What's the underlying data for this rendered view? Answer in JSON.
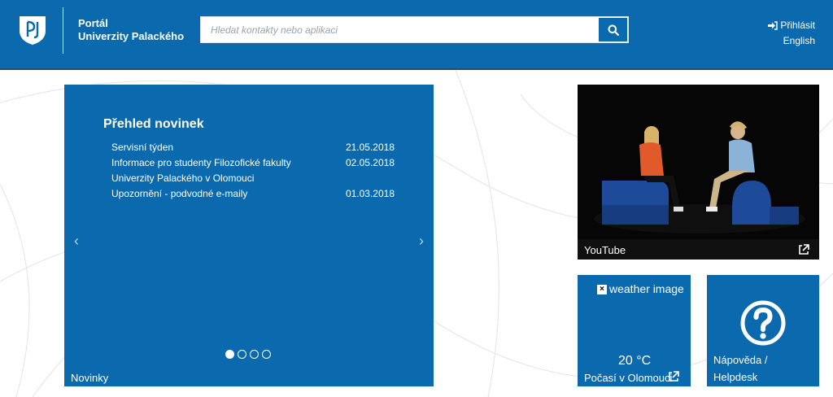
{
  "header": {
    "title_line1": "Portál",
    "title_line2": "Univerzity Palackého",
    "search_placeholder": "Hledat kontakty nebo aplikaci",
    "login_label": "Přihlásit",
    "language_label": "English"
  },
  "news_tile": {
    "heading": "Přehled novinek",
    "items": [
      {
        "title": "Servisní týden",
        "date": "21.05.2018"
      },
      {
        "title": "Informace pro studenty Filozofické fakulty Univerzity Palackého v Olomouci",
        "date": "02.05.2018"
      },
      {
        "title": "Upozornění - podvodné e-maily",
        "date": "01.03.2018"
      }
    ],
    "prev_arrow": "‹",
    "next_arrow": "›",
    "slide_count": 4,
    "active_slide": 1,
    "label": "Novinky"
  },
  "youtube_tile": {
    "label": "YouTube"
  },
  "weather_tile": {
    "image_alt": "weather image",
    "temperature": "20 °C",
    "label": "Počasí v Olomouci"
  },
  "help_tile": {
    "label": "Nápověda / Helpdesk"
  },
  "colors": {
    "brand_blue": "#0a6aad",
    "header_border": "#1f4e79"
  },
  "icons": [
    "university-logo-icon",
    "search-icon",
    "login-icon",
    "external-link-icon",
    "broken-image-icon",
    "help-question-icon"
  ]
}
